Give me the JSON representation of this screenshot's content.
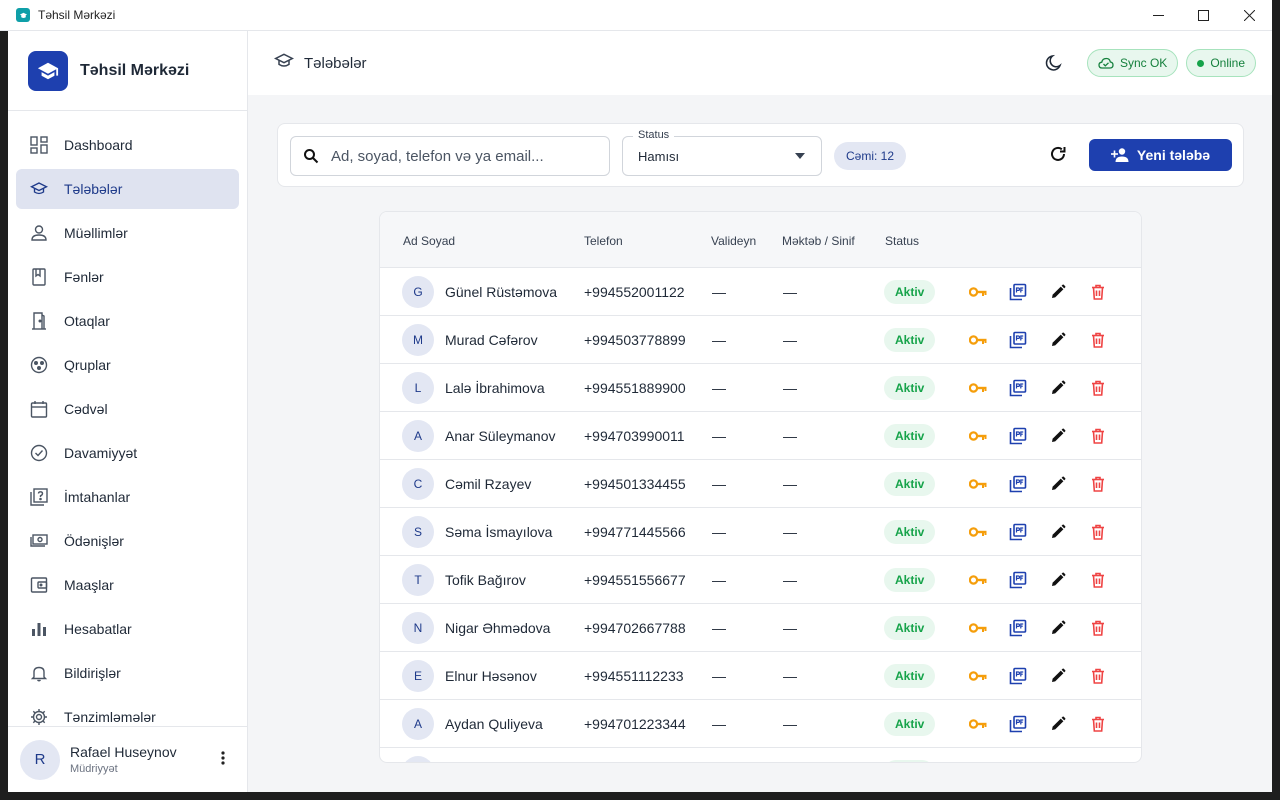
{
  "window": {
    "title": "Təhsil Mərkəzi"
  },
  "brand": {
    "name": "Təhsil Mərkəzi"
  },
  "sidebar": {
    "items": [
      {
        "label": "Dashboard",
        "icon": "dashboard-icon"
      },
      {
        "label": "Tələbələr",
        "icon": "graduation-cap-icon",
        "active": true
      },
      {
        "label": "Müəllimlər",
        "icon": "person-icon"
      },
      {
        "label": "Fənlər",
        "icon": "book-icon"
      },
      {
        "label": "Otaqlar",
        "icon": "door-icon"
      },
      {
        "label": "Qruplar",
        "icon": "group-icon"
      },
      {
        "label": "Cədvəl",
        "icon": "calendar-icon"
      },
      {
        "label": "Davamiyyət",
        "icon": "check-circle-icon"
      },
      {
        "label": "İmtahanlar",
        "icon": "quiz-icon"
      },
      {
        "label": "Ödənişlər",
        "icon": "payments-icon"
      },
      {
        "label": "Maaşlar",
        "icon": "wallet-icon"
      },
      {
        "label": "Hesabatlar",
        "icon": "bar-chart-icon"
      },
      {
        "label": "Bildirişlər",
        "icon": "bell-icon"
      },
      {
        "label": "Tənzimləmələr",
        "icon": "gear-icon"
      }
    ]
  },
  "user": {
    "initial": "R",
    "name": "Rafael Huseynov",
    "role": "Müdriyyət"
  },
  "header": {
    "title": "Tələbələr",
    "sync_label": "Sync OK",
    "online_label": "Online"
  },
  "toolbar": {
    "search_placeholder": "Ad, soyad, telefon və ya email...",
    "status_label": "Status",
    "status_value": "Hamısı",
    "count_label": "Cəmi: 12",
    "new_button_label": "Yeni tələbə"
  },
  "table": {
    "columns": [
      "Ad Soyad",
      "Telefon",
      "Valideyn",
      "Məktəb / Sinif",
      "Status"
    ],
    "rows": [
      {
        "initial": "G",
        "name": "Günel Rüstəmova",
        "phone": "+994552001122",
        "parent": "—",
        "school": "—",
        "status": "Aktiv"
      },
      {
        "initial": "M",
        "name": "Murad Cəfərov",
        "phone": "+994503778899",
        "parent": "—",
        "school": "—",
        "status": "Aktiv"
      },
      {
        "initial": "L",
        "name": "Lalə İbrahimova",
        "phone": "+994551889900",
        "parent": "—",
        "school": "—",
        "status": "Aktiv"
      },
      {
        "initial": "A",
        "name": "Anar Süleymanov",
        "phone": "+994703990011",
        "parent": "—",
        "school": "—",
        "status": "Aktiv"
      },
      {
        "initial": "C",
        "name": "Cəmil Rzayev",
        "phone": "+994501334455",
        "parent": "—",
        "school": "—",
        "status": "Aktiv"
      },
      {
        "initial": "S",
        "name": "Səma İsmayılova",
        "phone": "+994771445566",
        "parent": "—",
        "school": "—",
        "status": "Aktiv"
      },
      {
        "initial": "T",
        "name": "Tofik Bağırov",
        "phone": "+994551556677",
        "parent": "—",
        "school": "—",
        "status": "Aktiv"
      },
      {
        "initial": "N",
        "name": "Nigar Əhmədova",
        "phone": "+994702667788",
        "parent": "—",
        "school": "—",
        "status": "Aktiv"
      },
      {
        "initial": "E",
        "name": "Elnur Həsənov",
        "phone": "+994551112233",
        "parent": "—",
        "school": "—",
        "status": "Aktiv"
      },
      {
        "initial": "A",
        "name": "Aydan Quliyeva",
        "phone": "+994701223344",
        "parent": "—",
        "school": "—",
        "status": "Aktiv"
      }
    ],
    "row_actions": [
      "key-icon",
      "pdf-icon",
      "edit-icon",
      "delete-icon"
    ]
  },
  "colors": {
    "primary": "#1e40af",
    "success": "#16a34a",
    "key": "#f59e0b",
    "danger": "#ef4444"
  }
}
